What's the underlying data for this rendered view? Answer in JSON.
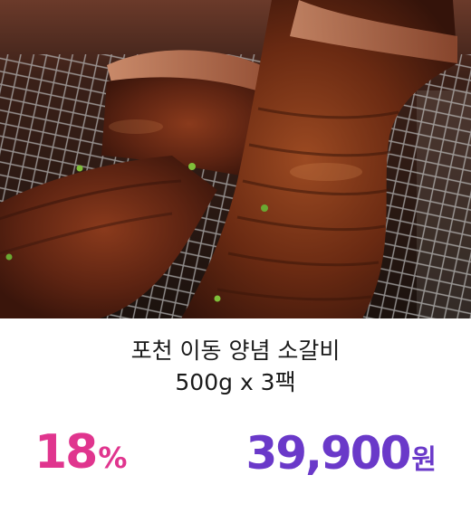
{
  "product": {
    "name_line1": "포천 이동 양념 소갈비",
    "name_line2": "500g x 3팩",
    "discount_value": "18",
    "discount_unit": "%",
    "price_value": "39,900",
    "price_unit": "원"
  },
  "colors": {
    "discount": "#e0358e",
    "price": "#6a39c9",
    "title": "#1a1a1a"
  },
  "image": {
    "subject": "marinated grilled beef ribs on a wire grill"
  }
}
